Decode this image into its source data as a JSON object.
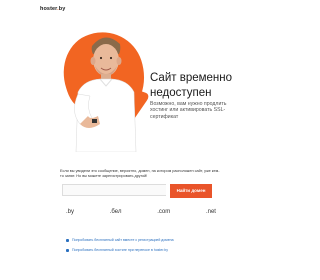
{
  "logo": {
    "name": "hoster",
    "dot": ".",
    "tld": "by"
  },
  "hero": {
    "title": "Сайт временно недоступен",
    "subtitle": "Возможно, вам нужно продлить хостинг или активировать SSL-сертификат"
  },
  "note": "Если вы увидели это сообщение, вероятно, домен, на котором расположен сайт, уже кем-то занят. Но вы можете зарегистрировать другой!",
  "search": {
    "placeholder": "",
    "button_label": "Найти домен"
  },
  "zones": [
    ".by",
    ".бел",
    ".com",
    ".net"
  ],
  "links": [
    "Попробовать бесплатный сайт вместе с регистрацией домена",
    "Попробовать бесплатный хостинг при переносе в hoster.by"
  ],
  "colors": {
    "accent": "#f26522",
    "button": "#e9542a",
    "link": "#2a6fbf"
  }
}
